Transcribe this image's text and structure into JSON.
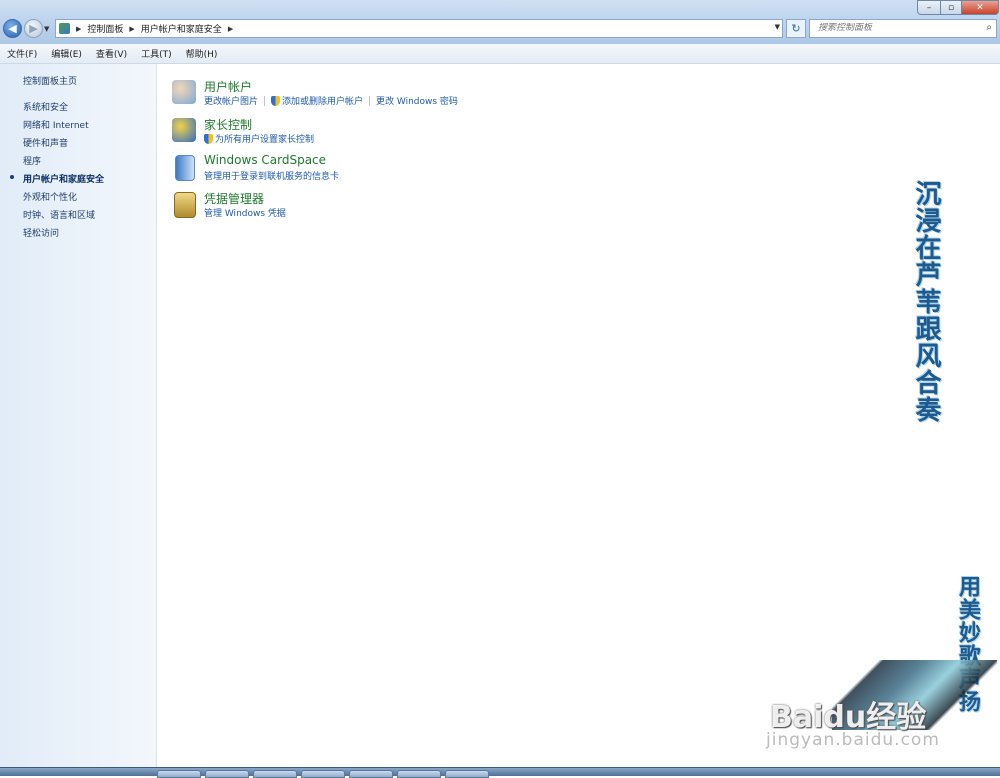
{
  "window": {
    "minimize_glyph": "–",
    "maximize_glyph": "▫",
    "close_glyph": "✕"
  },
  "nav": {
    "back_glyph": "◀",
    "forward_glyph": "▶"
  },
  "address": {
    "icon": "control-panel-icon",
    "crumbs": [
      "控制面板",
      "用户帐户和家庭安全"
    ]
  },
  "search": {
    "placeholder": "搜索控制面板"
  },
  "menu": [
    "文件(F)",
    "编辑(E)",
    "查看(V)",
    "工具(T)",
    "帮助(H)"
  ],
  "sidebar": {
    "home": "控制面板主页",
    "items": [
      {
        "label": "系统和安全"
      },
      {
        "label": "网络和 Internet"
      },
      {
        "label": "硬件和声音"
      },
      {
        "label": "程序"
      },
      {
        "label": "用户帐户和家庭安全",
        "active": true
      },
      {
        "label": "外观和个性化"
      },
      {
        "label": "时钟、语言和区域"
      },
      {
        "label": "轻松访问"
      }
    ]
  },
  "categories": [
    {
      "title": "用户帐户",
      "icon": "users-icon",
      "links": [
        "更改帐户图片",
        "添加或删除用户帐户",
        "更改 Windows 密码"
      ]
    },
    {
      "title": "家长控制",
      "icon": "parental-controls-icon",
      "links": [
        "为所有用户设置家长控制"
      ]
    },
    {
      "title": "Windows CardSpace",
      "icon": "cardspace-icon",
      "links": [
        "管理用于登录到联机服务的信息卡"
      ]
    },
    {
      "title": "凭据管理器",
      "icon": "credential-vault-icon",
      "links": [
        "管理 Windows 凭据"
      ]
    }
  ],
  "overlay": {
    "verse1": "沉浸在芦苇跟风合奏",
    "verse2": "用美妙歌声扬",
    "watermark": "Baidu经验",
    "watermark_url": "jingyan.baidu.com"
  },
  "colors": {
    "link": "#1f5aa8",
    "category_title": "#1f7a2e",
    "sidebar_bg": "#e1ecf8"
  }
}
